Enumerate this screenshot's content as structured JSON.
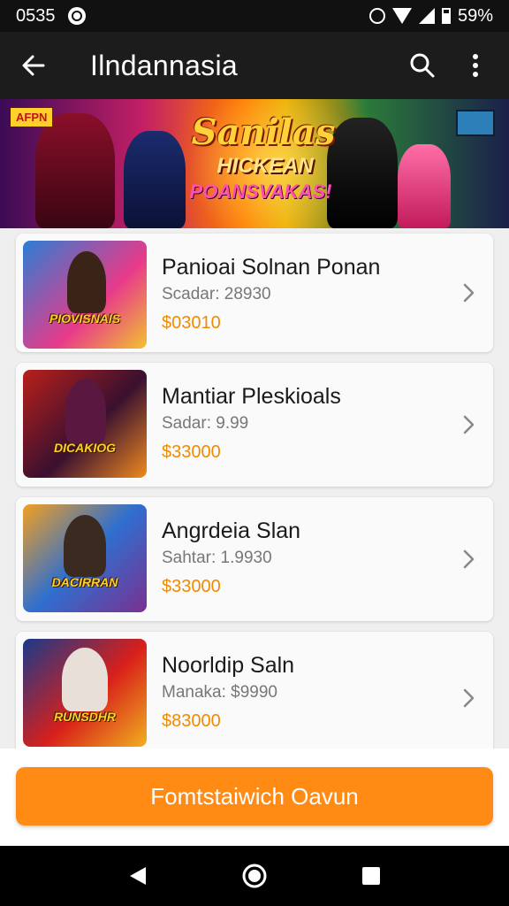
{
  "status_bar": {
    "time": "0535",
    "battery": "59%",
    "icons": [
      "notification-icon",
      "alarm-icon",
      "wifi-icon",
      "signal-icon",
      "battery-icon"
    ]
  },
  "app_bar": {
    "title": "Ilndannasia",
    "icons": [
      "back-arrow-icon",
      "search-icon",
      "more-vert-icon"
    ]
  },
  "banner": {
    "badge": "AFPN",
    "title": "Sanilas",
    "subtitle_1": "HICKEAN",
    "subtitle_2": "POANSVAKAS!"
  },
  "games": [
    {
      "title": "Panioai Solnan Ponan",
      "subtitle": "Scadar: 28930",
      "price": "$03010",
      "thumb_label": "PIOVISNAIS",
      "colors": [
        "#2a7fd4",
        "#e83a8a",
        "#f2c230"
      ]
    },
    {
      "title": "Mantiar Pleskioals",
      "subtitle": "Sadar: 9.99",
      "price": "$33000",
      "thumb_label": "DICAKIOG",
      "colors": [
        "#b8201a",
        "#3a1030",
        "#f08a20"
      ]
    },
    {
      "title": "Angrdeia Slan",
      "subtitle": "Sahtar: 1.9930",
      "price": "$33000",
      "thumb_label": "DACIRRAN",
      "colors": [
        "#2f6fcf",
        "#f2a020",
        "#7a3090"
      ]
    },
    {
      "title": "Noorldip Saln",
      "subtitle": "Manaka: $9990",
      "price": "$83000",
      "thumb_label": "RUNSDHR",
      "colors": [
        "#1a3a8a",
        "#d8201a",
        "#f0b020"
      ]
    }
  ],
  "cta": {
    "label": "Fomtstaiwich Oavun"
  },
  "nav_bar": {
    "icons": [
      "nav-back-icon",
      "nav-home-icon",
      "nav-recents-icon"
    ]
  },
  "colors": {
    "accent": "#ff8a14",
    "price": "#f28a00",
    "app_bar": "#1c1c1c",
    "background": "#efefef"
  }
}
